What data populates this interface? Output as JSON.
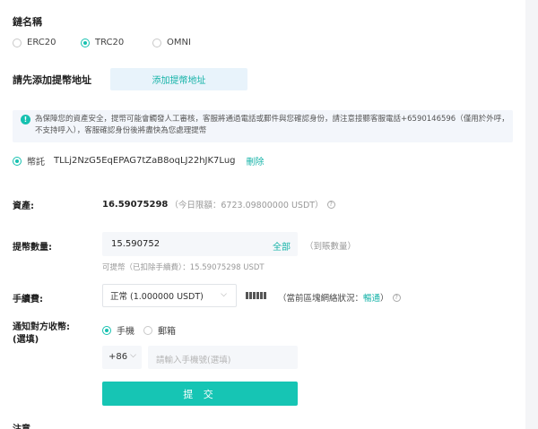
{
  "chain": {
    "title": "鏈名稱",
    "options": [
      "ERC20",
      "TRC20",
      "OMNI"
    ],
    "selected_index": 1
  },
  "address": {
    "title": "請先添加提幣地址",
    "add_button": "添加提幣地址"
  },
  "notice": {
    "icon": "!",
    "text_before": "為保障您的資產安全，提幣可能會觸發人工審核，客服將通過電話或郵件與您確認身份，請注意接聽客服電話+6590146596（僅用於外呼，不支持呼入），客服確認身份後將盡快為您處理提幣"
  },
  "saved_address": {
    "tag": "幣託",
    "value": "TLLj2NzG5EqEPAG7tZaB8oqLJ22hJK7Lug",
    "delete": "刪除"
  },
  "assets": {
    "label": "資產:",
    "amount": "16.59075298",
    "limit": "（今日限額：6723.09800000 USDT）"
  },
  "withdraw": {
    "label": "提幣數量:",
    "value": "15.590752",
    "all": "全部",
    "arrival": "（到賬數量）",
    "available": "可提幣（已扣除手續費）：15.59075298 USDT"
  },
  "fee": {
    "label": "手續費:",
    "selected": "正常 (1.000000 USDT)",
    "network_prefix": "（當前區塊網絡狀況：",
    "network_status": "暢通",
    "network_suffix": "）"
  },
  "notify": {
    "label_line1": "通知對方收幣:",
    "label_line2": "(選填)",
    "options": [
      "手機",
      "郵箱"
    ],
    "country_code": "+86",
    "phone_placeholder": "請輸入手機號(選填)"
  },
  "submit_label": "提 交",
  "bottom_partial": "注意"
}
